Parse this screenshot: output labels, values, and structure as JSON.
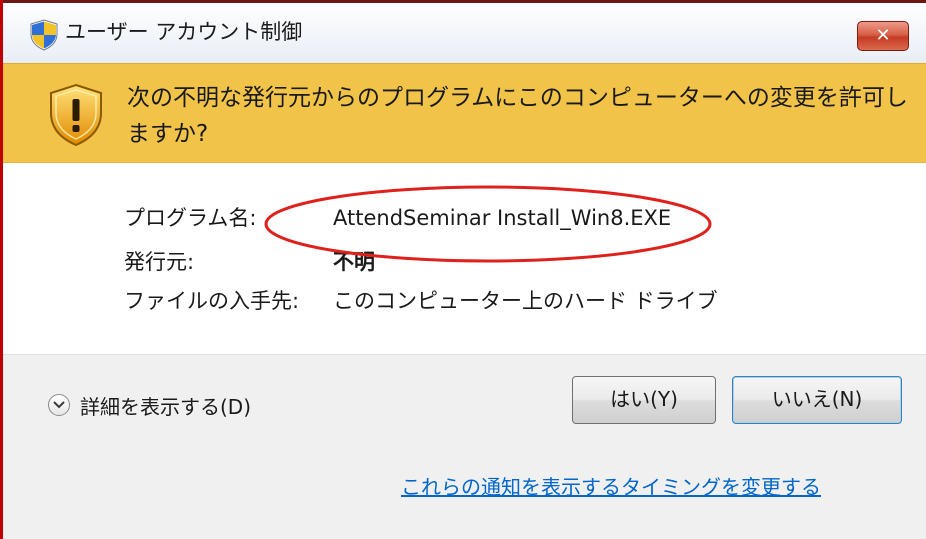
{
  "window": {
    "title": "ユーザー アカウント制御",
    "close_label": "✕"
  },
  "banner": {
    "message": "次の不明な発行元からのプログラムにこのコンピューターへの変更を許可しますか?"
  },
  "info": {
    "program_label": "プログラム名:",
    "program_value": "AttendSeminar Install_Win8.EXE",
    "publisher_label": "発行元:",
    "publisher_value": "不明",
    "origin_label": "ファイルの入手先:",
    "origin_value": "このコンピューター上のハード ドライブ"
  },
  "footer": {
    "details_label": "詳細を表示する(D)",
    "yes_label": "はい(Y)",
    "no_label": "いいえ(N)",
    "notification_link": "これらの通知を表示するタイミングを変更する"
  },
  "icons": {
    "title": "uac-shield-icon",
    "banner": "warning-shield-icon",
    "details": "chevron-down-icon"
  },
  "colors": {
    "banner_bg": "#f1c348",
    "link": "#0066cc",
    "highlight_ellipse": "#e0201b",
    "close_button": "#c53b24"
  }
}
